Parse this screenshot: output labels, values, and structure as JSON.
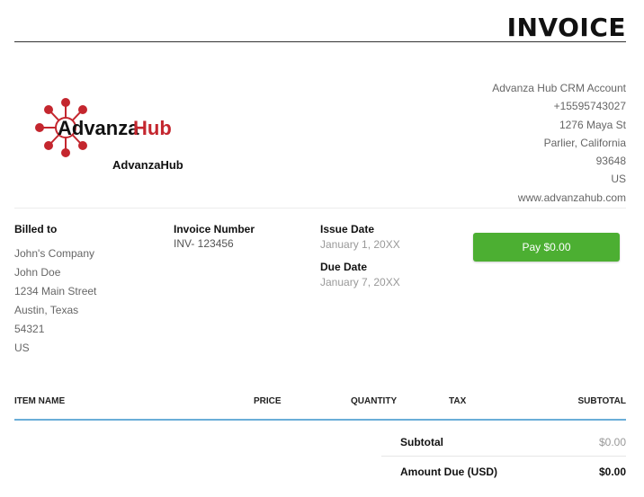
{
  "header": {
    "title": "INVOICE"
  },
  "brand": {
    "logo_text_dark": "Advanza",
    "logo_text_red": "Hub",
    "caption": "AdvanzaHub",
    "colors": {
      "red": "#c4262e",
      "dark": "#111111"
    }
  },
  "company": {
    "lines": [
      "Advanza Hub CRM Account",
      "+15595743027",
      "1276 Maya St",
      "Parlier, California",
      "93648",
      "US",
      "www.advanzahub.com"
    ]
  },
  "billed": {
    "label": "Billed to",
    "lines": [
      "John's Company",
      "John Doe",
      "1234 Main Street",
      "Austin, Texas",
      "54321",
      "US"
    ]
  },
  "invoice": {
    "number_label": "Invoice Number",
    "number_value": "INV- 123456"
  },
  "dates": {
    "issue_label": "Issue Date",
    "issue_value": "January 1, 20XX",
    "due_label": "Due Date",
    "due_value": "January 7, 20XX"
  },
  "pay": {
    "label": "Pay $0.00",
    "color": "#4caf32"
  },
  "table": {
    "columns": [
      "ITEM NAME",
      "PRICE",
      "QUANTITY",
      "TAX",
      "SUBTOTAL"
    ],
    "rows": []
  },
  "totals": {
    "subtotal_label": "Subtotal",
    "subtotal_value": "$0.00",
    "amount_due_label": "Amount Due (USD)",
    "amount_due_value": "$0.00"
  }
}
